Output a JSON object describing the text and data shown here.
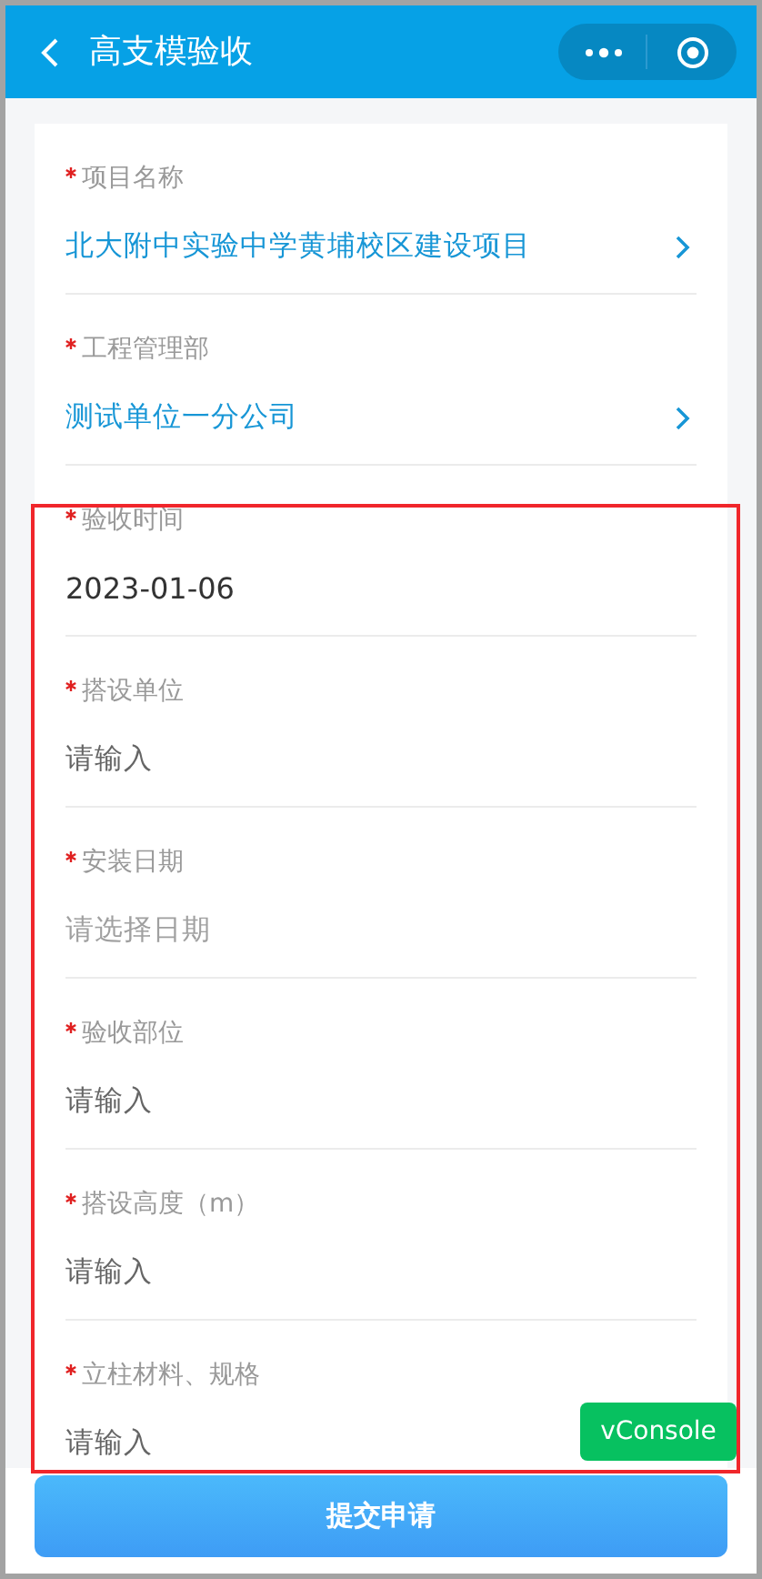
{
  "header": {
    "title": "高支模验收"
  },
  "fields": [
    {
      "kind": "select",
      "label": "项目名称",
      "required": true,
      "value": "北大附中实验中学黄埔校区建设项目"
    },
    {
      "kind": "select",
      "label": "工程管理部",
      "required": true,
      "value": "测试单位一分公司"
    },
    {
      "kind": "value",
      "label": "验收时间",
      "required": true,
      "value": "2023-01-06"
    },
    {
      "kind": "input",
      "label": "搭设单位",
      "required": true,
      "placeholder": "请输入"
    },
    {
      "kind": "date",
      "label": "安装日期",
      "required": true,
      "placeholder": "请选择日期"
    },
    {
      "kind": "input",
      "label": "验收部位",
      "required": true,
      "placeholder": "请输入"
    },
    {
      "kind": "input",
      "label": "搭设高度（m）",
      "required": true,
      "placeholder": "请输入"
    },
    {
      "kind": "input",
      "label": "立柱材料、规格",
      "required": true,
      "placeholder": "请输入"
    }
  ],
  "vconsole": "vConsole",
  "submit_button": "提交申请"
}
